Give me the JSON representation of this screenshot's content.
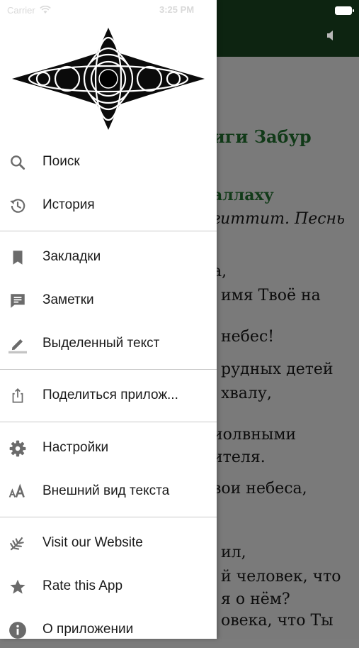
{
  "status_bar": {
    "carrier": "Carrier",
    "time": "3:25 PM"
  },
  "reader": {
    "lines": [
      {
        "text": "иги Забур",
        "style": "title"
      },
      {
        "text": "аллаху",
        "style": "sub"
      },
      {
        "text": "гиттит. Песнь",
        "style": "it"
      },
      {
        "text": "а,",
        "style": ""
      },
      {
        "text": "имя Твоё на",
        "style": ""
      },
      {
        "text": "небес!",
        "style": ""
      },
      {
        "text": "рудных детей",
        "style": ""
      },
      {
        "text": "хвалу,",
        "style": ""
      },
      {
        "text": "иолвными",
        "style": ""
      },
      {
        "text": "ителя.",
        "style": ""
      },
      {
        "text": "вои небеса,",
        "style": ""
      },
      {
        "text": "ил,",
        "style": ""
      },
      {
        "text": "й человек, что",
        "style": ""
      },
      {
        "text": "я о нём?",
        "style": ""
      },
      {
        "text": "овека, что Ты",
        "style": ""
      }
    ]
  },
  "drawer": {
    "menu": [
      {
        "id": "search",
        "label": "Поиск",
        "icon": "search-icon"
      },
      {
        "id": "history",
        "label": "История",
        "icon": "history-icon"
      },
      {
        "id": "bookmarks",
        "label": "Закладки",
        "icon": "bookmark-icon"
      },
      {
        "id": "notes",
        "label": "Заметки",
        "icon": "note-icon"
      },
      {
        "id": "highlights",
        "label": "Выделенный текст",
        "icon": "highlighter-icon"
      },
      {
        "id": "share",
        "label": "Поделиться прилож...",
        "icon": "share-icon"
      },
      {
        "id": "settings",
        "label": "Настройки",
        "icon": "gear-icon"
      },
      {
        "id": "text-appearance",
        "label": "Внешний вид текста",
        "icon": "text-size-icon"
      },
      {
        "id": "website",
        "label": "Visit our Website",
        "icon": "website-icon"
      },
      {
        "id": "rate",
        "label": "Rate this App",
        "icon": "star-icon"
      },
      {
        "id": "about",
        "label": "О приложении",
        "icon": "info-icon"
      }
    ]
  },
  "colors": {
    "header_green": "#0d2411",
    "title_green": "#113a18",
    "scrim": "#7a7a7a",
    "icon_grey": "#6b6b6b"
  }
}
